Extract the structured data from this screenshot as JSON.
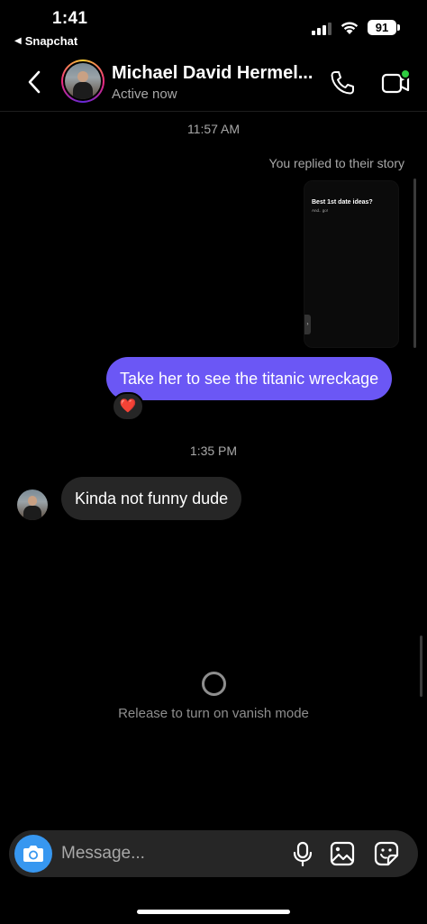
{
  "status_bar": {
    "time": "1:41",
    "back_app": "Snapchat",
    "battery": "91"
  },
  "header": {
    "name": "Michael David Hermel...",
    "status": "Active now"
  },
  "chat": {
    "timestamp_1": "11:57 AM",
    "replied_label": "You replied to their story",
    "story": {
      "title": "Best 1st date ideas?",
      "subtitle": "And.. go!"
    },
    "outgoing_message": "Take her to see the titanic wreckage",
    "reaction": "❤️",
    "timestamp_2": "1:35 PM",
    "incoming_message": "Kinda not funny dude"
  },
  "vanish": {
    "text": "Release to turn on vanish mode"
  },
  "composer": {
    "placeholder": "Message..."
  },
  "colors": {
    "outgoing_bubble": "#6b57f5",
    "incoming_bubble": "#262626",
    "camera_button": "#3797f0",
    "online_dot": "#2ecc40"
  }
}
